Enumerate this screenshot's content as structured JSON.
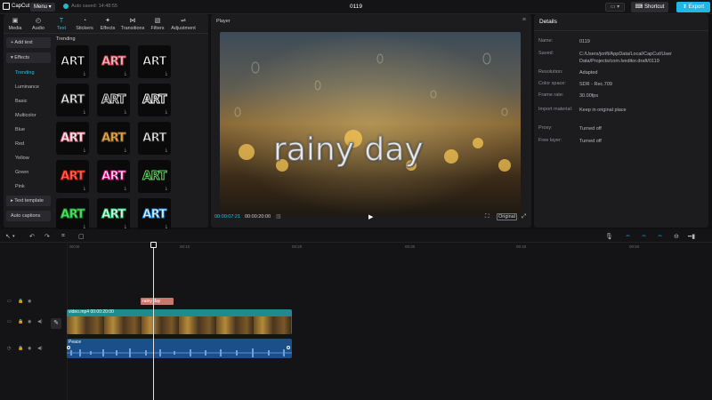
{
  "app": {
    "name": "CapCut",
    "menu_label": "Menu",
    "autosave_text": "Auto saved: 14:48:55",
    "project_title": "0119"
  },
  "topbar": {
    "layout_label": "▭ ▾",
    "shortcut_label": "⌨ Shortcut",
    "export_label": "⬆ Export"
  },
  "toptabs": [
    {
      "icon": "▣",
      "label": "Media"
    },
    {
      "icon": "◴",
      "label": "Audio"
    },
    {
      "icon": "T",
      "label": "Text"
    },
    {
      "icon": "◔",
      "label": "Stickers"
    },
    {
      "icon": "✦",
      "label": "Effects"
    },
    {
      "icon": "⋈",
      "label": "Transitions"
    },
    {
      "icon": "▧",
      "label": "Filters"
    },
    {
      "icon": "⇌",
      "label": "Adjustment"
    }
  ],
  "sidebar": {
    "add_text": "+ Add text",
    "effects": "▾ Effects",
    "subitems": [
      "Trending",
      "Luminance",
      "Basic",
      "Multicolor",
      "Blue",
      "Red",
      "Yellow",
      "Green",
      "Pink"
    ],
    "text_template": "▸ Text template",
    "auto_captions": "Auto captions"
  },
  "text_grid": {
    "heading": "Trending",
    "cards": [
      {
        "label": "ART",
        "color": "#ffffff",
        "stroke": "#000000"
      },
      {
        "label": "ART",
        "color": "#f4d0d6",
        "stroke": "#c93c4a"
      },
      {
        "label": "ART",
        "color": "#ffffff",
        "stroke": "#000000"
      },
      {
        "label": "ART",
        "color": "#ffffff",
        "stroke": "#333333"
      },
      {
        "label": "ART",
        "color": "#0a0a0b",
        "stroke": "#dddddd"
      },
      {
        "label": "ART",
        "color": "#0a0a0b",
        "stroke": "#ffffff"
      },
      {
        "label": "ART",
        "color": "#ffffff",
        "stroke": "#e0708a"
      },
      {
        "label": "ART",
        "color": "#e8b860",
        "stroke": "#8a5a1a"
      },
      {
        "label": "ART",
        "color": "#ffffff",
        "stroke": "#222222"
      },
      {
        "label": "ART",
        "color": "#ff7755",
        "stroke": "#c81818"
      },
      {
        "label": "ART",
        "color": "#ffffff",
        "stroke": "#e0108a"
      },
      {
        "label": "ART",
        "color": "#0a0a0b",
        "stroke": "#60d860"
      },
      {
        "label": "ART",
        "color": "#60e870",
        "stroke": "#18a030"
      },
      {
        "label": "ART",
        "color": "#ffffff",
        "stroke": "#22c870"
      },
      {
        "label": "ART",
        "color": "#ffffff",
        "stroke": "#1c8ce0"
      }
    ]
  },
  "player": {
    "title": "Player",
    "overlay_text": "rainy day",
    "time_current": "00:00:07:21",
    "time_total": "00:00:20:00",
    "original_label": "Original"
  },
  "details": {
    "title": "Details",
    "rows": [
      {
        "label": "Name:",
        "value": "0119"
      },
      {
        "label": "Saved:",
        "value": "C:/Users/jorifi/AppData/Local/CapCut/User Data/Projects/com.lveditor.draft/0119"
      },
      {
        "label": "Resolution:",
        "value": "Adapted"
      },
      {
        "label": "Color space:",
        "value": "SDR - Rec.709"
      },
      {
        "label": "Frame rate:",
        "value": "30.00fps"
      },
      {
        "label": "Import material:",
        "value": "Keep in original place"
      },
      {
        "label": "Proxy:",
        "value": "Turned off"
      },
      {
        "label": "Free layer:",
        "value": "Turned off"
      }
    ]
  },
  "timeline": {
    "ruler": [
      "00:00",
      "00:10",
      "00:20",
      "00:30",
      "00:40",
      "00:50"
    ],
    "text_clip": "rainy day",
    "video_clip": "video.mp4  00:00:20:00",
    "audio_clip": "Peace"
  }
}
